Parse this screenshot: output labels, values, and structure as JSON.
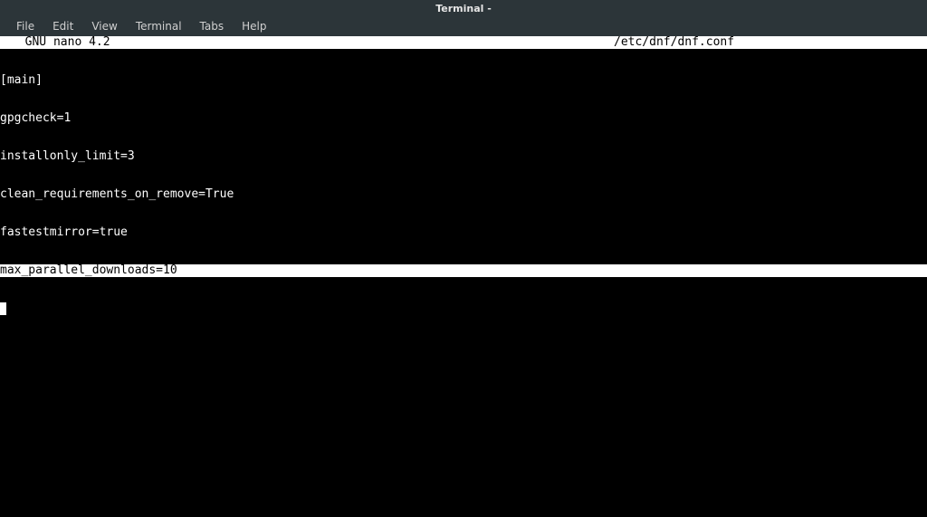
{
  "window": {
    "title": "Terminal -"
  },
  "menu": {
    "items": [
      "File",
      "Edit",
      "View",
      "Terminal",
      "Tabs",
      "Help"
    ]
  },
  "nano": {
    "app_label": "  GNU nano 4.2",
    "filename": "/etc/dnf/dnf.conf"
  },
  "editor": {
    "lines": [
      "[main]",
      "gpgcheck=1",
      "installonly_limit=3",
      "clean_requirements_on_remove=True",
      "fastestmirror=true"
    ],
    "highlighted_line": "max_parallel_downloads=10"
  }
}
